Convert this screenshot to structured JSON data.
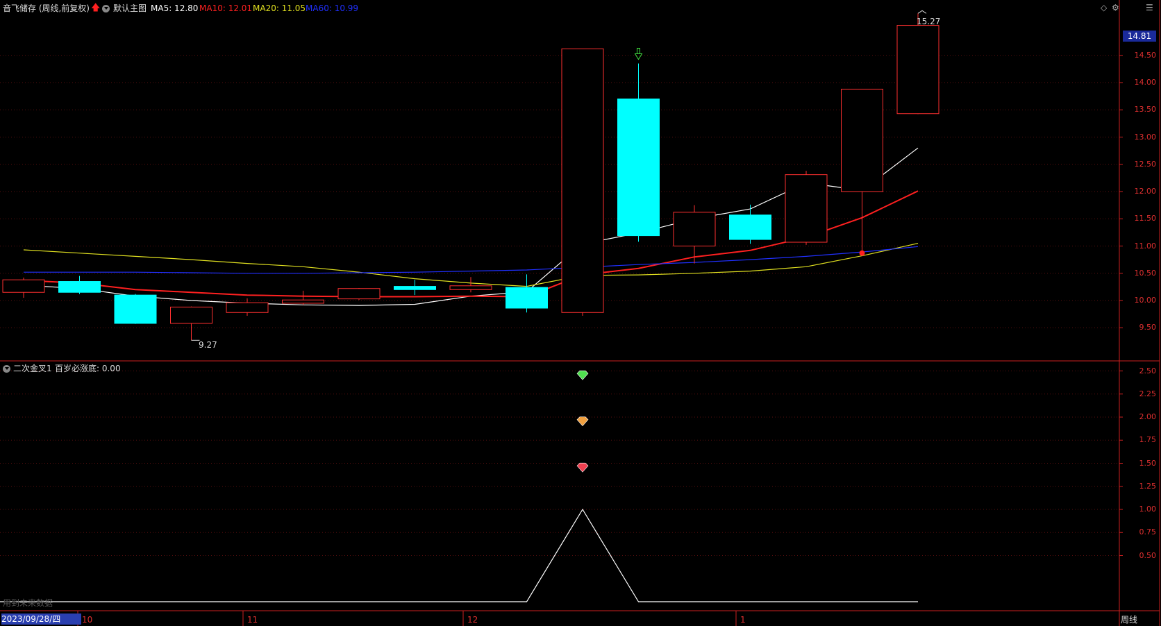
{
  "header": {
    "stock_title": "音飞储存 (周线,前复权)",
    "main_chart_label": "默认主图",
    "ma5": "MA5: 12.80",
    "ma10": "MA10: 12.01",
    "ma20": "MA20: 11.05",
    "ma60": "MA60: 10.99"
  },
  "indicator": {
    "label": "二次金叉1",
    "value_text": "百岁必涨底: 0.00"
  },
  "price_tag": "14.81",
  "annotations": {
    "high": "15.27",
    "low": "9.27"
  },
  "bottom": {
    "date": "2023/09/28/四",
    "period": "周线",
    "watermark": "用到未来数据",
    "months": [
      "10",
      "11",
      "12",
      "1"
    ]
  },
  "colors": {
    "up": "#ff3030",
    "down": "#00ffff",
    "ma5": "#ffffff",
    "ma10": "#ff2020",
    "ma20": "#e0e020",
    "ma60": "#2030ff",
    "axis": "#cc2020"
  },
  "chart_data": [
    {
      "type": "candlestick",
      "y_ticks": [
        "14.50",
        "14.00",
        "13.50",
        "13.00",
        "12.50",
        "12.00",
        "11.50",
        "11.00",
        "10.50",
        "10.00",
        "9.50"
      ],
      "candles": [
        {
          "open": 10.15,
          "close": 10.38,
          "high": 10.42,
          "low": 10.05
        },
        {
          "open": 10.35,
          "close": 10.15,
          "high": 10.45,
          "low": 10.12
        },
        {
          "open": 10.1,
          "close": 9.58,
          "high": 10.12,
          "low": 9.57
        },
        {
          "open": 9.58,
          "close": 9.88,
          "high": 9.89,
          "low": 9.27
        },
        {
          "open": 9.78,
          "close": 9.96,
          "high": 10.04,
          "low": 9.72
        },
        {
          "open": 9.95,
          "close": 10.01,
          "high": 10.18,
          "low": 9.92
        },
        {
          "open": 10.03,
          "close": 10.22,
          "high": 10.23,
          "low": 10.01
        },
        {
          "open": 10.26,
          "close": 10.2,
          "high": 10.38,
          "low": 10.1
        },
        {
          "open": 10.2,
          "close": 10.27,
          "high": 10.43,
          "low": 10.15
        },
        {
          "open": 10.24,
          "close": 9.86,
          "high": 10.48,
          "low": 9.78
        },
        {
          "open": 9.78,
          "close": 14.62,
          "high": 14.62,
          "low": 9.72
        },
        {
          "open": 13.7,
          "close": 11.19,
          "high": 14.35,
          "low": 11.08
        },
        {
          "open": 11.0,
          "close": 11.62,
          "high": 11.75,
          "low": 10.68
        },
        {
          "open": 11.57,
          "close": 11.12,
          "high": 11.76,
          "low": 11.04
        },
        {
          "open": 11.07,
          "close": 12.31,
          "high": 12.38,
          "low": 11.02
        },
        {
          "open": 12.0,
          "close": 13.88,
          "high": 13.88,
          "low": 10.87
        },
        {
          "open": 13.43,
          "close": 15.05,
          "high": 15.27,
          "low": 13.42
        }
      ],
      "series": [
        {
          "name": "MA5",
          "values": [
            10.28,
            10.22,
            10.08,
            10.0,
            9.95,
            9.92,
            9.91,
            9.93,
            10.08,
            10.16,
            11.04,
            11.24,
            11.5,
            11.68,
            12.16,
            12.02,
            12.8
          ]
        },
        {
          "name": "MA10",
          "values": [
            10.37,
            10.32,
            10.2,
            10.15,
            10.1,
            10.08,
            10.07,
            10.07,
            10.08,
            10.07,
            10.47,
            10.59,
            10.8,
            10.92,
            11.16,
            11.52,
            12.01
          ]
        },
        {
          "name": "MA20",
          "values": [
            10.93,
            10.87,
            10.81,
            10.75,
            10.68,
            10.62,
            10.52,
            10.4,
            10.32,
            10.26,
            10.46,
            10.47,
            10.5,
            10.54,
            10.62,
            10.82,
            11.05
          ]
        },
        {
          "name": "MA60",
          "values": [
            10.52,
            10.52,
            10.52,
            10.51,
            10.5,
            10.5,
            10.51,
            10.52,
            10.54,
            10.56,
            10.61,
            10.66,
            10.7,
            10.75,
            10.81,
            10.89,
            10.99
          ]
        }
      ]
    },
    {
      "type": "line",
      "y_ticks": [
        "2.50",
        "2.25",
        "2.00",
        "1.75",
        "1.50",
        "1.25",
        "1.00",
        "0.75",
        "0.50"
      ],
      "series": [
        {
          "name": "百岁必涨底",
          "values": [
            0,
            0,
            0,
            0,
            0,
            0,
            0,
            0,
            0,
            0,
            1,
            0,
            0,
            0,
            0,
            0,
            0
          ]
        }
      ],
      "markers": [
        {
          "value": 2.45,
          "color": "#50e050"
        },
        {
          "value": 1.95,
          "color": "#f0a040"
        },
        {
          "value": 1.45,
          "color": "#f04050"
        }
      ]
    }
  ]
}
